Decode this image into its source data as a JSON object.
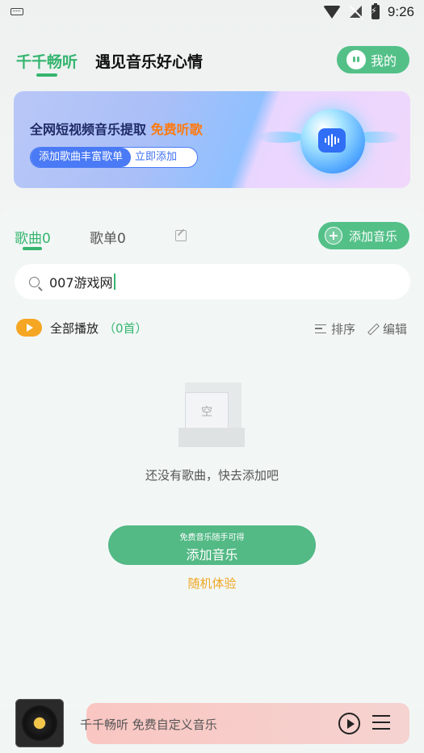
{
  "status_bar": {
    "time": "9:26"
  },
  "header": {
    "tab_active": "千千畅听",
    "tab_slogan": "遇见音乐好心情",
    "me_label": "我的"
  },
  "banner": {
    "title": "全网短视频音乐提取",
    "title_highlight": "免费听歌",
    "pill_left": "添加歌曲丰富歌单",
    "pill_right": "立即添加"
  },
  "library": {
    "tab_songs": "歌曲0",
    "tab_playlists": "歌单0",
    "add_music_label": "添加音乐"
  },
  "search": {
    "value": "007游戏网"
  },
  "list_toolbar": {
    "play_all": "全部播放",
    "count": "（0首）",
    "sort": "排序",
    "edit": "编辑"
  },
  "empty": {
    "placeholder_char": "空",
    "message": "还没有歌曲，快去添加吧",
    "button_sub": "免费音乐随手可得",
    "button_main": "添加音乐",
    "random_link": "随机体验"
  },
  "player": {
    "text": "千千畅听 免费自定义音乐"
  },
  "colors": {
    "accent": "#35b56f",
    "button": "#53c088",
    "orange": "#f5a623",
    "hot": "#ff7a10"
  }
}
